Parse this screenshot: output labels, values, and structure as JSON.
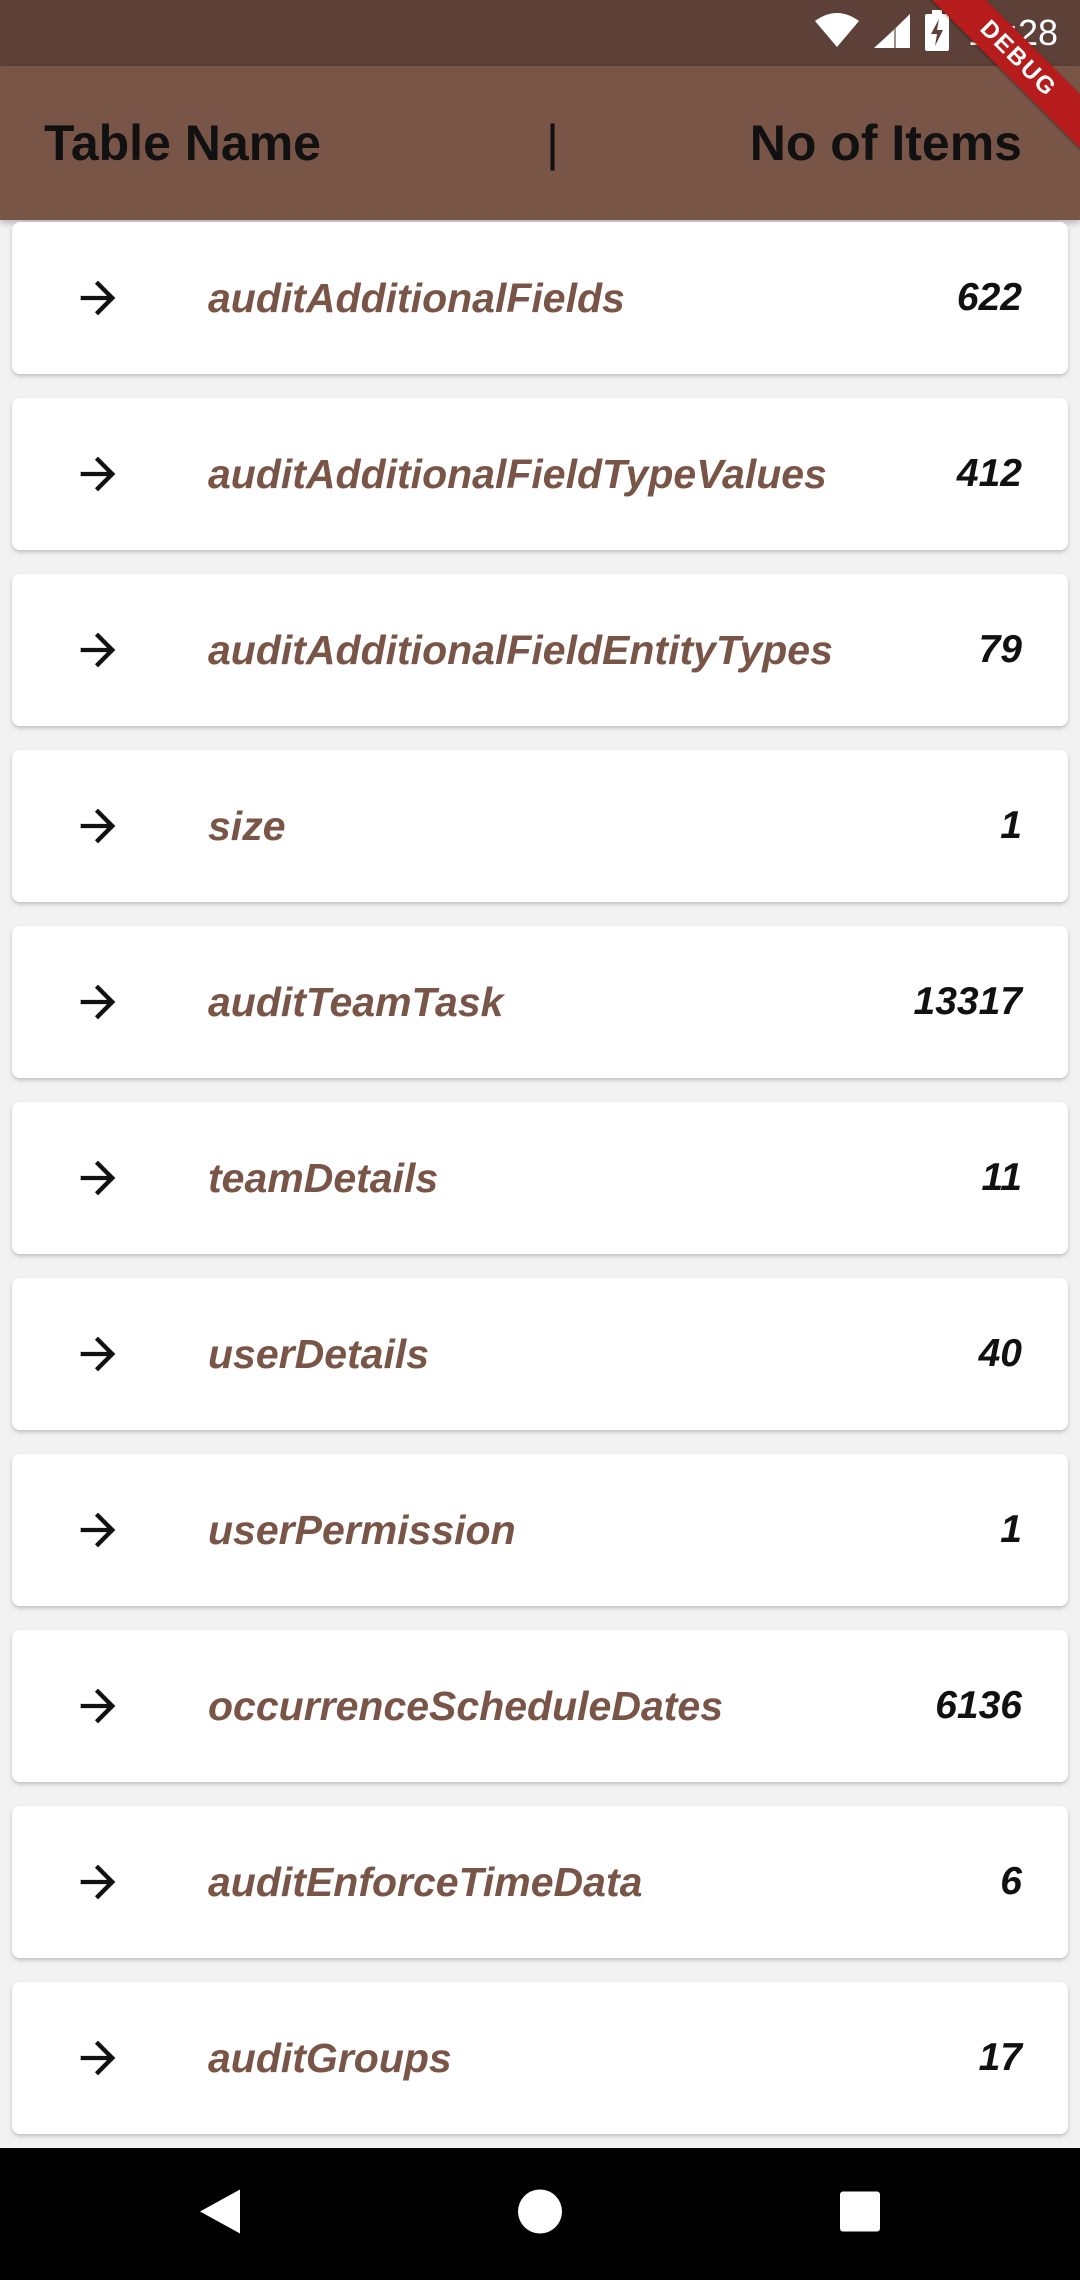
{
  "status_bar": {
    "time": "12:28",
    "icons": [
      "wifi-icon",
      "signal-icon",
      "battery-charging-icon"
    ]
  },
  "debug_banner": "DEBUG",
  "header": {
    "left_label": "Table Name",
    "separator": "|",
    "right_label": "No of Items"
  },
  "rows": [
    {
      "name": "auditAdditionalFields",
      "count": "622"
    },
    {
      "name": "auditAdditionalFieldTypeValues",
      "count": "412"
    },
    {
      "name": "auditAdditionalFieldEntityTypes",
      "count": "79"
    },
    {
      "name": "size",
      "count": "1"
    },
    {
      "name": "auditTeamTask",
      "count": "13317"
    },
    {
      "name": "teamDetails",
      "count": "11"
    },
    {
      "name": "userDetails",
      "count": "40"
    },
    {
      "name": "userPermission",
      "count": "1"
    },
    {
      "name": "occurrenceScheduleDates",
      "count": "6136"
    },
    {
      "name": "auditEnforceTimeData",
      "count": "6"
    },
    {
      "name": "auditGroups",
      "count": "17"
    }
  ],
  "colors": {
    "status_bar": "#5d4037",
    "app_bar": "#795548",
    "row_name": "#795548",
    "debug": "#b71c1c"
  },
  "nav_bar": {
    "buttons": [
      "back-icon",
      "home-icon",
      "recents-icon"
    ]
  }
}
